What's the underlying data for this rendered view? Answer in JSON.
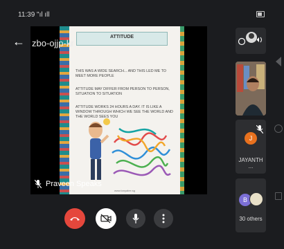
{
  "status_bar": {
    "time": "11:39 \"ıl ıll"
  },
  "meeting": {
    "code": "zbo-ojjp-kro"
  },
  "presentation": {
    "slide_title": "ATTITUDE",
    "paragraph1": "THIS WAS A WIDE SEARCH... AND THIS LED ME TO MEET MORE PEOPLE",
    "paragraph2": "ATTITUDE MAY DIFFER FROM PERSON TO PERSON, SITUATION TO SITUATION",
    "paragraph3": "ATTITUDE WORKS 24 HOURS A DAY. IT IS LIKE A WINDOW THROUGH WHICH WE SEE THE WORLD AND THE WORLD SEES YOU",
    "footer": "www.tonyalee.sg"
  },
  "speaker": {
    "name": "Praveen Speaks"
  },
  "participants": {
    "jayanth": {
      "initial": "J",
      "name": "JAYANTH ..."
    },
    "others": {
      "initial": "B",
      "label": "30 others"
    }
  },
  "colors": {
    "end_call": "#e5473c",
    "avatar_j": "#e8711e",
    "avatar_b": "#7b6fd6"
  },
  "icons": {
    "back": "arrow-left-icon",
    "end": "phone-end-icon",
    "camera": "camera-off-icon",
    "mic": "mic-icon",
    "more": "more-vert-icon"
  }
}
